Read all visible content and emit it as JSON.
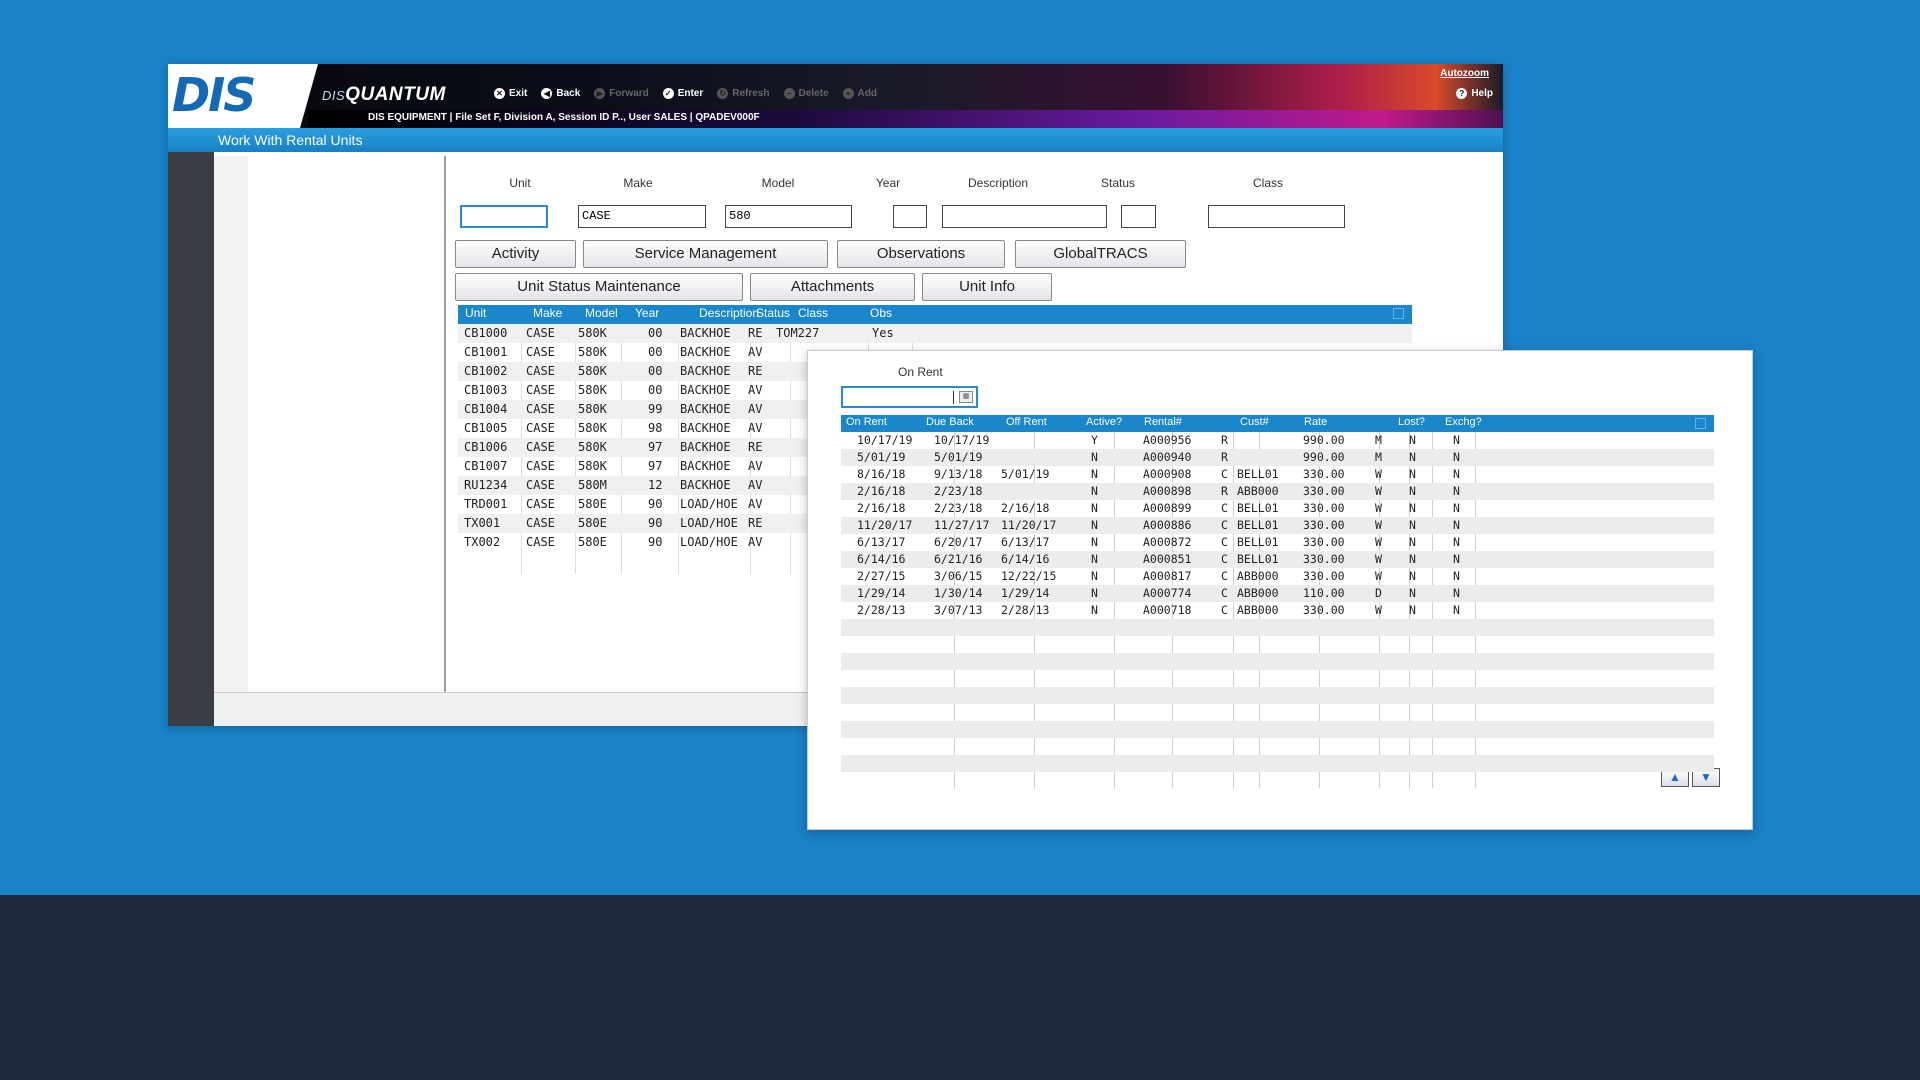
{
  "app": {
    "logo": "DIS",
    "product_prefix": "DIS",
    "product_name": "QUANTUM",
    "session_info": "DIS EQUIPMENT | File Set F, Division A, Session ID P.., User SALES | QPADEV000F",
    "autozoom_label": "Autozoom",
    "help_label": "Help",
    "page_title": "Work With Rental Units"
  },
  "toolbar": [
    {
      "label": "Exit",
      "icon": "x-circle-icon",
      "enabled": true
    },
    {
      "label": "Back",
      "icon": "arrow-left-circle-icon",
      "enabled": true
    },
    {
      "label": "Forward",
      "icon": "arrow-right-circle-icon",
      "enabled": false
    },
    {
      "label": "Enter",
      "icon": "check-circle-icon",
      "enabled": true
    },
    {
      "label": "Refresh",
      "icon": "refresh-icon",
      "enabled": false
    },
    {
      "label": "Delete",
      "icon": "minus-circle-icon",
      "enabled": false
    },
    {
      "label": "Add",
      "icon": "plus-circle-icon",
      "enabled": false
    }
  ],
  "filters": {
    "labels": {
      "unit": "Unit",
      "make": "Make",
      "model": "Model",
      "year": "Year",
      "description": "Description",
      "status": "Status",
      "class": "Class"
    },
    "values": {
      "unit": "",
      "make": "CASE",
      "model": "580",
      "year": "",
      "description": "",
      "status": "",
      "class": ""
    }
  },
  "option_buttons": {
    "activity": "Activity",
    "service_management": "Service Management",
    "observations": "Observations",
    "globaltracs": "GlobalTRACS",
    "unit_status_maintenance": "Unit Status Maintenance",
    "attachments": "Attachments",
    "unit_info": "Unit Info"
  },
  "units_table": {
    "headers": [
      "Unit",
      "Make",
      "Model",
      "Year",
      "Description",
      "Status",
      "Class",
      "Obs"
    ],
    "rows": [
      [
        "CB1000",
        "CASE",
        "580K",
        "00",
        "BACKHOE",
        "RE",
        "TOM227",
        "Yes"
      ],
      [
        "CB1001",
        "CASE",
        "580K",
        "00",
        "BACKHOE",
        "AV",
        "",
        ""
      ],
      [
        "CB1002",
        "CASE",
        "580K",
        "00",
        "BACKHOE",
        "RE",
        "",
        ""
      ],
      [
        "CB1003",
        "CASE",
        "580K",
        "00",
        "BACKHOE",
        "AV",
        "",
        ""
      ],
      [
        "CB1004",
        "CASE",
        "580K",
        "99",
        "BACKHOE",
        "AV",
        "",
        ""
      ],
      [
        "CB1005",
        "CASE",
        "580K",
        "98",
        "BACKHOE",
        "AV",
        "",
        ""
      ],
      [
        "CB1006",
        "CASE",
        "580K",
        "97",
        "BACKHOE",
        "RE",
        "",
        ""
      ],
      [
        "CB1007",
        "CASE",
        "580K",
        "97",
        "BACKHOE",
        "AV",
        "",
        ""
      ],
      [
        "RU1234",
        "CASE",
        "580M",
        "12",
        "BACKHOE",
        "AV",
        "",
        ""
      ],
      [
        "TRD001",
        "CASE",
        "580E",
        "90",
        "LOAD/HOE",
        "AV",
        "",
        ""
      ],
      [
        "TX001",
        "CASE",
        "580E",
        "90",
        "LOAD/HOE",
        "RE",
        "",
        ""
      ],
      [
        "TX002",
        "CASE",
        "580E",
        "90",
        "LOAD/HOE",
        "AV",
        "",
        ""
      ]
    ]
  },
  "rental_popup": {
    "on_rent_label": "On Rent",
    "on_rent_value": "",
    "headers": [
      "On Rent",
      "Due Back",
      "Off Rent",
      "Active?",
      "Rental#",
      "",
      "Cust#",
      "Rate",
      "",
      "Lost?",
      "Exchg?"
    ],
    "rows": [
      [
        "10/17/19",
        "10/17/19",
        "",
        "Y",
        "A000956",
        "R",
        "",
        "990.00",
        "M",
        "N",
        "N"
      ],
      [
        "5/01/19",
        "5/01/19",
        "",
        "N",
        "A000940",
        "R",
        "",
        "990.00",
        "M",
        "N",
        "N"
      ],
      [
        "8/16/18",
        "9/13/18",
        "5/01/19",
        "N",
        "A000908",
        "C",
        "BELL01",
        "330.00",
        "W",
        "N",
        "N"
      ],
      [
        "2/16/18",
        "2/23/18",
        "",
        "N",
        "A000898",
        "R",
        "ABB000",
        "330.00",
        "W",
        "N",
        "N"
      ],
      [
        "2/16/18",
        "2/23/18",
        "2/16/18",
        "N",
        "A000899",
        "C",
        "BELL01",
        "330.00",
        "W",
        "N",
        "N"
      ],
      [
        "11/20/17",
        "11/27/17",
        "11/20/17",
        "N",
        "A000886",
        "C",
        "BELL01",
        "330.00",
        "W",
        "N",
        "N"
      ],
      [
        "6/13/17",
        "6/20/17",
        "6/13/17",
        "N",
        "A000872",
        "C",
        "BELL01",
        "330.00",
        "W",
        "N",
        "N"
      ],
      [
        "6/14/16",
        "6/21/16",
        "6/14/16",
        "N",
        "A000851",
        "C",
        "BELL01",
        "330.00",
        "W",
        "N",
        "N"
      ],
      [
        "2/27/15",
        "3/06/15",
        "12/22/15",
        "N",
        "A000817",
        "C",
        "ABB000",
        "330.00",
        "W",
        "N",
        "N"
      ],
      [
        "1/29/14",
        "1/30/14",
        "1/29/14",
        "N",
        "A000774",
        "C",
        "ABB000",
        "110.00",
        "D",
        "N",
        "N"
      ],
      [
        "2/28/13",
        "3/07/13",
        "2/28/13",
        "N",
        "A000718",
        "C",
        "ABB000",
        "330.00",
        "W",
        "N",
        "N"
      ]
    ],
    "empty_rows": 9,
    "page_up_icon": "arrow-up-icon",
    "page_down_icon": "arrow-down-icon"
  }
}
